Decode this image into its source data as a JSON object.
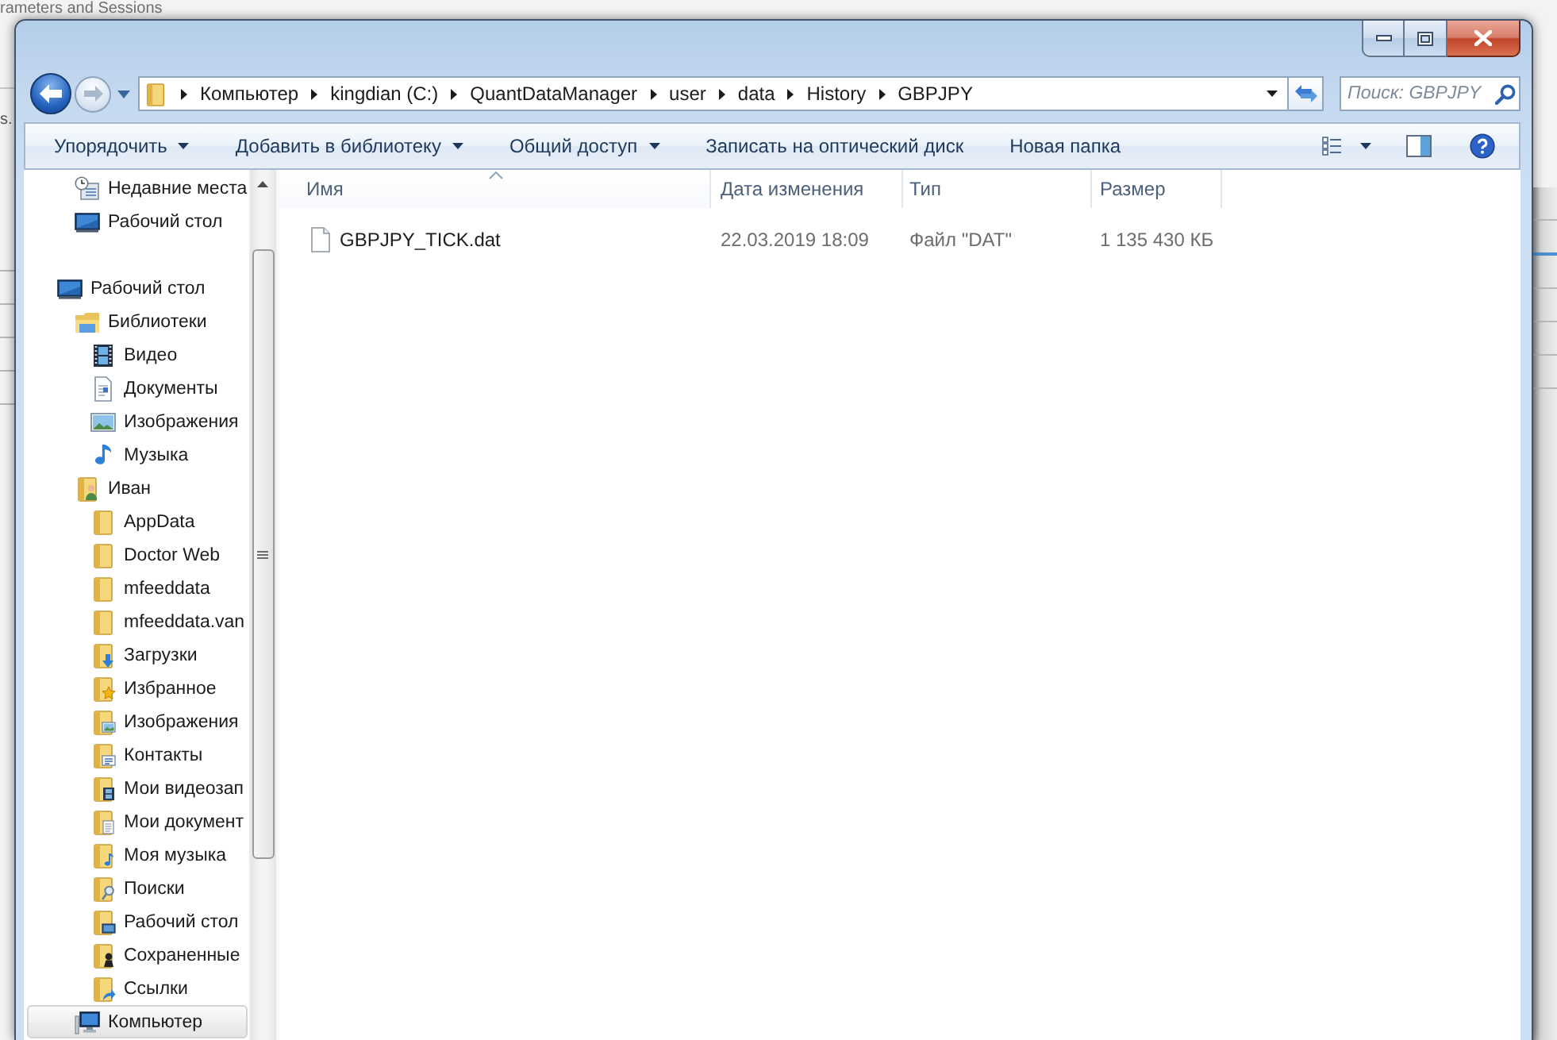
{
  "background_window": {
    "top_text": "rameters and Sessions",
    "left_text": "s."
  },
  "navigation": {
    "back": {
      "disabled": false
    },
    "forward": {
      "disabled": true
    }
  },
  "address_bar": {
    "path": [
      "Компьютер",
      "kingdian (C:)",
      "QuantDataManager",
      "user",
      "data",
      "History",
      "GBPJPY"
    ]
  },
  "search": {
    "placeholder": "Поиск: GBPJPY"
  },
  "toolbar": {
    "items": [
      {
        "label": "Упорядочить",
        "dropdown": true
      },
      {
        "label": "Добавить в библиотеку",
        "dropdown": true
      },
      {
        "label": "Общий доступ",
        "dropdown": true
      },
      {
        "label": "Записать на оптический диск",
        "dropdown": false
      },
      {
        "label": "Новая папка",
        "dropdown": false
      }
    ]
  },
  "navigation_pane": {
    "favorites": [
      {
        "label": "Недавние места",
        "kind": "recent",
        "selected": false
      },
      {
        "label": "Рабочий стол",
        "kind": "desktop",
        "selected": false
      }
    ],
    "tree": [
      {
        "label": "Рабочий стол",
        "kind": "desktop",
        "selected": false,
        "children": [
          {
            "label": "Библиотеки",
            "kind": "library",
            "selected": false,
            "children": [
              {
                "label": "Видео",
                "kind": "video",
                "selected": false
              },
              {
                "label": "Документы",
                "kind": "documents",
                "selected": false
              },
              {
                "label": "Изображения",
                "kind": "pictures",
                "selected": false
              },
              {
                "label": "Музыка",
                "kind": "music",
                "selected": false
              }
            ]
          },
          {
            "label": "Иван",
            "kind": "user",
            "selected": false,
            "children": [
              {
                "label": "AppData",
                "kind": "folder",
                "selected": false
              },
              {
                "label": "Doctor Web",
                "kind": "folder",
                "selected": false
              },
              {
                "label": "mfeeddata",
                "kind": "folder",
                "selected": false
              },
              {
                "label": "mfeeddata.van",
                "kind": "folder",
                "selected": false
              },
              {
                "label": "Загрузки",
                "kind": "downloads",
                "selected": false
              },
              {
                "label": "Избранное",
                "kind": "favorites",
                "selected": false
              },
              {
                "label": "Изображения",
                "kind": "pictures-folder",
                "selected": false
              },
              {
                "label": "Контакты",
                "kind": "contacts",
                "selected": false
              },
              {
                "label": "Мои видеозап",
                "kind": "video-folder",
                "selected": false
              },
              {
                "label": "Мои документ",
                "kind": "documents-folder",
                "selected": false
              },
              {
                "label": "Моя музыка",
                "kind": "music-folder",
                "selected": false
              },
              {
                "label": "Поиски",
                "kind": "searches",
                "selected": false
              },
              {
                "label": "Рабочий стол",
                "kind": "desktop-folder",
                "selected": false
              },
              {
                "label": "Сохраненные",
                "kind": "saved-games",
                "selected": false
              },
              {
                "label": "Ссылки",
                "kind": "links",
                "selected": false
              }
            ]
          },
          {
            "label": "Компьютер",
            "kind": "computer",
            "selected": true
          }
        ]
      }
    ]
  },
  "file_list": {
    "columns": [
      {
        "label": "Имя",
        "sorted": true
      },
      {
        "label": "Дата изменения",
        "sorted": false
      },
      {
        "label": "Тип",
        "sorted": false
      },
      {
        "label": "Размер",
        "sorted": false
      }
    ],
    "files": [
      {
        "name": "GBPJPY_TICK.dat",
        "date_modified": "22.03.2019 18:09",
        "type": "Файл \"DAT\"",
        "size": "1 135 430 КБ",
        "selected": false
      }
    ]
  }
}
